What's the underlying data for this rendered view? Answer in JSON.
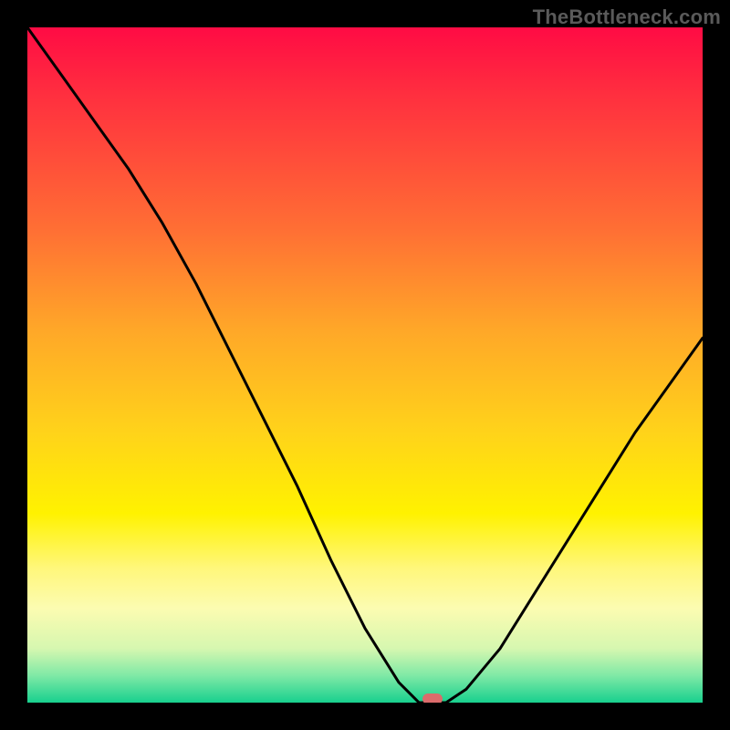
{
  "watermark": "TheBottleneck.com",
  "chart_data": {
    "type": "line",
    "title": "",
    "xlabel": "",
    "ylabel": "",
    "x": [
      0.0,
      0.05,
      0.1,
      0.15,
      0.2,
      0.25,
      0.3,
      0.35,
      0.4,
      0.45,
      0.5,
      0.55,
      0.58,
      0.62,
      0.65,
      0.7,
      0.75,
      0.8,
      0.85,
      0.9,
      0.95,
      1.0
    ],
    "values": [
      1.0,
      0.93,
      0.86,
      0.79,
      0.71,
      0.62,
      0.52,
      0.42,
      0.32,
      0.21,
      0.11,
      0.03,
      0.0,
      0.0,
      0.02,
      0.08,
      0.16,
      0.24,
      0.32,
      0.4,
      0.47,
      0.54
    ],
    "ylim": [
      0,
      1
    ],
    "xlim": [
      0,
      1
    ],
    "marker": {
      "x": 0.6,
      "y": 0.0
    },
    "colors": {
      "line": "#000000",
      "marker": "#db6b6b",
      "gradient_stops": [
        "#ff0b44",
        "#fff200",
        "#18d08e"
      ]
    }
  }
}
